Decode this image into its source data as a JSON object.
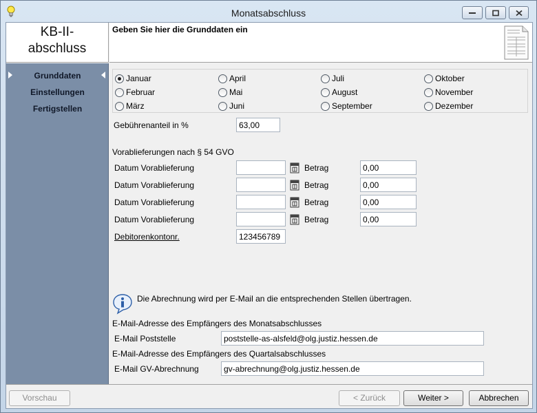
{
  "window": {
    "title": "Monatsabschluss"
  },
  "header": {
    "brand": "KB-II-\nabschluss",
    "subtitle": "Geben Sie hier die Grunddaten ein"
  },
  "sidebar": {
    "items": [
      {
        "label": "Grunddaten",
        "active": true
      },
      {
        "label": "Einstellungen",
        "active": false
      },
      {
        "label": "Fertigstellen",
        "active": false
      }
    ]
  },
  "months": {
    "selected": "Januar",
    "options": [
      "Januar",
      "Februar",
      "März",
      "April",
      "Mai",
      "Juni",
      "Juli",
      "August",
      "September",
      "Oktober",
      "November",
      "Dezember"
    ]
  },
  "fee": {
    "label": "Gebührenanteil in %",
    "value": "63,00"
  },
  "advance": {
    "heading": "Vorablieferungen nach § 54 GVO",
    "rows": [
      {
        "date_label": "Datum Vorablieferung",
        "date_value": "",
        "amount_label": "Betrag",
        "amount_value": "0,00"
      },
      {
        "date_label": "Datum Vorablieferung",
        "date_value": "",
        "amount_label": "Betrag",
        "amount_value": "0,00"
      },
      {
        "date_label": "Datum Vorablieferung",
        "date_value": "",
        "amount_label": "Betrag",
        "amount_value": "0,00"
      },
      {
        "date_label": "Datum Vorablieferung",
        "date_value": "",
        "amount_label": "Betrag",
        "amount_value": "0,00"
      }
    ]
  },
  "debitor": {
    "label": "Debitorenkontonr.",
    "value": "123456789"
  },
  "info": {
    "text": "Die Abrechnung wird per E-Mail an die entsprechenden Stellen übertragen."
  },
  "email": {
    "monthly_heading": "E-Mail-Adresse des Empfängers des Monatsabschlusses",
    "monthly_label": "E-Mail Poststelle",
    "monthly_value": "poststelle-as-alsfeld@olg.justiz.hessen.de",
    "quarterly_heading": "E-Mail-Adresse des Empfängers des Quartalsabschlusses",
    "quarterly_label": "E-Mail GV-Abrechnung",
    "quarterly_value": "gv-abrechnung@olg.justiz.hessen.de"
  },
  "footer": {
    "preview": "Vorschau",
    "back": "< Zurück",
    "next": "Weiter >",
    "cancel": "Abbrechen"
  },
  "icons": {
    "app": "lightbulb-icon",
    "document": "document-icon",
    "info": "info-icon",
    "calendar": "calendar-icon"
  }
}
